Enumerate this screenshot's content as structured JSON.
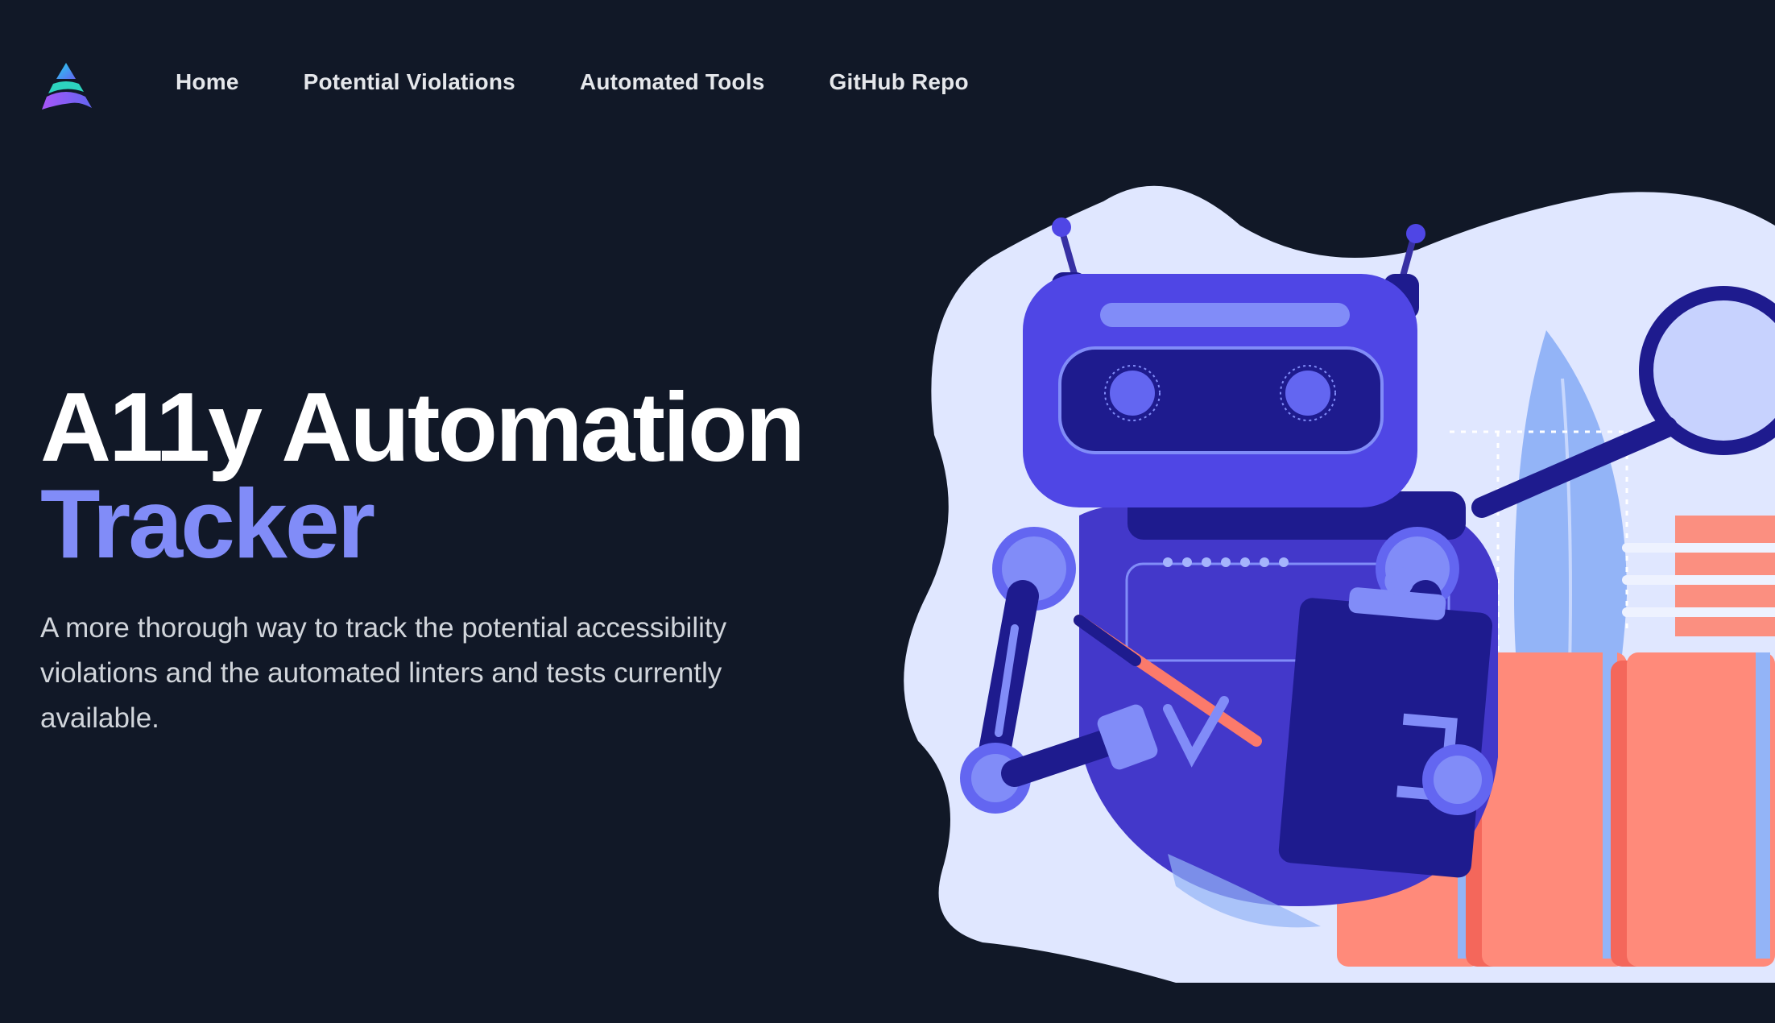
{
  "nav": {
    "items": [
      {
        "label": "Home"
      },
      {
        "label": "Potential Violations"
      },
      {
        "label": "Automated Tools"
      },
      {
        "label": "GitHub Repo"
      }
    ]
  },
  "hero": {
    "title_line1": "A11y Automation",
    "title_line2": "Tracker",
    "description": "A more thorough way to track the potential accessibility violations and the automated linters and tests currently available."
  },
  "theme": {
    "background": "#111827",
    "accent": "#818cf8",
    "robot_primary": "#4f46e5",
    "folder_color": "#fa7a6e"
  },
  "icons": {
    "logo": "logo-icon",
    "illustration": "robot-illustration"
  }
}
